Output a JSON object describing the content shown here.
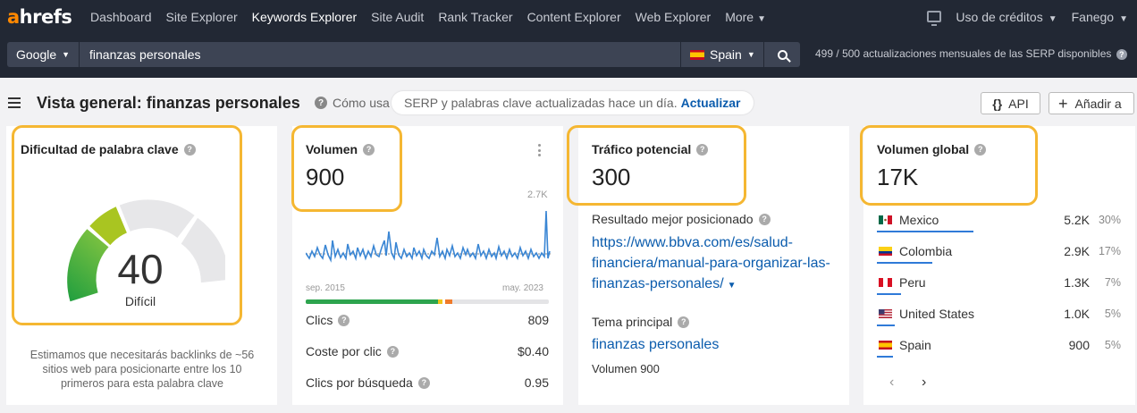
{
  "nav": {
    "logo_a": "a",
    "logo_rest": "hrefs",
    "items": [
      {
        "label": "Dashboard"
      },
      {
        "label": "Site Explorer"
      },
      {
        "label": "Keywords Explorer"
      },
      {
        "label": "Site Audit"
      },
      {
        "label": "Rank Tracker"
      },
      {
        "label": "Content Explorer"
      },
      {
        "label": "Web Explorer"
      },
      {
        "label": "More"
      }
    ],
    "active": "Keywords Explorer",
    "credits": "Uso de créditos",
    "user": "Fanego"
  },
  "search": {
    "engine": "Google",
    "query": "finanzas personales",
    "country": "Spain",
    "serp_used": "499",
    "serp_sep": "/",
    "serp_total": "500",
    "serp_text": "actualizaciones mensuales de las SERP disponibles"
  },
  "header": {
    "title": "Vista general: finanzas personales",
    "howto": "Cómo usa",
    "notice": "SERP y palabras clave actualizadas hace un día.",
    "notice_link": "Actualizar",
    "api_button": "API",
    "add_button": "Añadir a"
  },
  "kd": {
    "label": "Dificultad de palabra clave",
    "value": "40",
    "value_fraction": 0.4,
    "rating": "Difícil",
    "description": "Estimamos que necesitarás backlinks de ~56 sitios web para posicionarte entre los 10 primeros para esta palabra clave"
  },
  "volume": {
    "label": "Volumen",
    "value": "900",
    "chart_top": "2.7K",
    "chart_start": "sep. 2015",
    "chart_end": "may. 2023",
    "metrics": [
      {
        "label": "Clics",
        "value": "809"
      },
      {
        "label": "Coste por clic",
        "value": "$0.40"
      },
      {
        "label": "Clics por búsqueda",
        "value": "0.95"
      }
    ]
  },
  "traffic": {
    "label": "Tráfico potencial",
    "value": "300",
    "top_result_label": "Resultado mejor posicionado",
    "top_result_url": "https://www.bbva.com/es/salud-financiera/manual-para-organizar-las-finanzas-personales/",
    "topic_label": "Tema principal",
    "topic": "finanzas personales",
    "topic_volume": "Volumen 900"
  },
  "global": {
    "label": "Volumen global",
    "value": "17K",
    "countries": [
      {
        "name": "Mexico",
        "value": "5.2K",
        "pct": "30%",
        "share": 0.3
      },
      {
        "name": "Colombia",
        "value": "2.9K",
        "pct": "17%",
        "share": 0.17
      },
      {
        "name": "Peru",
        "value": "1.3K",
        "pct": "7%",
        "share": 0.07
      },
      {
        "name": "United States",
        "value": "1.0K",
        "pct": "5%",
        "share": 0.05
      },
      {
        "name": "Spain",
        "value": "900",
        "pct": "5%",
        "share": 0.05
      }
    ]
  },
  "colors": {
    "highlight": "#f5b732",
    "link": "#0b5cad",
    "nav_bg": "#222834"
  }
}
